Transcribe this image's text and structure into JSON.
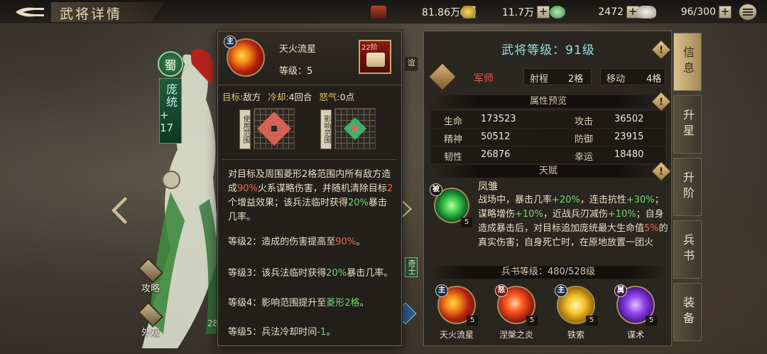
{
  "header": {
    "title": "武将详情",
    "resources": [
      {
        "icon": "food-icon",
        "value": "81.86万"
      },
      {
        "icon": "gold-coin-icon",
        "value": "11.7万"
      },
      {
        "icon": "jade-icon",
        "value": "2472"
      },
      {
        "icon": "silver-ingot-icon",
        "value": "96/300"
      }
    ],
    "plus": "+"
  },
  "hero": {
    "faction": "蜀",
    "name": "庞统",
    "level": "+ 17",
    "side_buttons": [
      {
        "label": "攻略"
      },
      {
        "label": "外观"
      }
    ],
    "tag_qishi": "奇士",
    "tag_small": "谊",
    "side_num": "28"
  },
  "popup": {
    "badge": "主",
    "skill_name": "天火流星",
    "skill_level": "等级：5",
    "rank": "22阶",
    "target_key": "目标",
    "target_val": "敌方",
    "cooldown_key": "冷却",
    "cooldown_val": "4回合",
    "rage_key": "怒气",
    "rage_val": "0点",
    "use_range_label": "使用范围",
    "effect_range_label": "影响范围",
    "desc_main": [
      {
        "t": "对目标及周围菱形2格范围内所有敌方造成"
      },
      {
        "t": "90%",
        "c": "hl"
      },
      {
        "t": "火系谋略伤害，并随机清除目标"
      },
      {
        "t": "2",
        "c": "hl"
      },
      {
        "t": "个增益效果；该兵法临时获得"
      },
      {
        "t": "20%",
        "c": "gr"
      },
      {
        "t": "暴击几率。"
      }
    ],
    "upgrades": [
      [
        {
          "t": "等级2：造成的伤害提高至"
        },
        {
          "t": "90%",
          "c": "hl"
        },
        {
          "t": "。"
        }
      ],
      [
        {
          "t": "等级3：该兵法临时获得"
        },
        {
          "t": "20%",
          "c": "gr"
        },
        {
          "t": "暴击几率。"
        }
      ],
      [
        {
          "t": "等级4：影响范围提升至"
        },
        {
          "t": "菱形2格",
          "c": "gr"
        },
        {
          "t": "。"
        }
      ],
      [
        {
          "t": "等级5：兵法冷却时间"
        },
        {
          "t": "-1",
          "c": "gr"
        },
        {
          "t": "。"
        }
      ]
    ]
  },
  "info": {
    "level_title": "武将等级：91级",
    "class_name": "军师",
    "range_label": "射程",
    "range_value": "2格",
    "move_label": "移动",
    "move_value": "4格",
    "attr_section": "属性预览",
    "stats": [
      {
        "k": "生命",
        "v": "173523"
      },
      {
        "k": "攻击",
        "v": "36502"
      },
      {
        "k": "精神",
        "v": "50512"
      },
      {
        "k": "防御",
        "v": "23915"
      },
      {
        "k": "韧性",
        "v": "26876"
      },
      {
        "k": "幸运",
        "v": "18480"
      }
    ],
    "talent_section": "天赋",
    "talent_badge": "被",
    "talent_level": "5",
    "talent_name": "凤雏",
    "talent_desc": [
      {
        "t": "战场中，暴击几率"
      },
      {
        "t": "+20%",
        "c": "gr"
      },
      {
        "t": "，连击抗性"
      },
      {
        "t": "+30%",
        "c": "gr"
      },
      {
        "t": "；谋略增伤"
      },
      {
        "t": "+10%",
        "c": "gr"
      },
      {
        "t": "，近战兵刃减伤"
      },
      {
        "t": "+10%",
        "c": "gr"
      },
      {
        "t": "；自身造成暴击后，对目标追加庞统最大生命值"
      },
      {
        "t": "5%",
        "c": "hl"
      },
      {
        "t": "的真实伤害；自身死亡时，在原地放置一团火"
      }
    ],
    "book_level": "兵书等级：480/528级",
    "skills": [
      {
        "badge": "主",
        "badge_type": "main",
        "style": "fire",
        "level": "5",
        "name": "天火流星"
      },
      {
        "badge": "怒",
        "badge_type": "nu",
        "style": "phoenix",
        "level": "5",
        "name": "涅槃之炎"
      },
      {
        "badge": "主",
        "badge_type": "main",
        "style": "gold",
        "level": "5",
        "name": "铁索"
      },
      {
        "badge": "属",
        "badge_type": "shu",
        "style": "purple",
        "level": "5",
        "name": "谋术"
      }
    ]
  },
  "tabs": [
    {
      "label": "信息",
      "active": true
    },
    {
      "label": "升星",
      "active": false
    },
    {
      "label": "升阶",
      "active": false
    },
    {
      "label": "兵书",
      "active": false
    },
    {
      "label": "装备",
      "active": false
    }
  ],
  "colors": {
    "highlight_red": "#e66a4a",
    "highlight_green": "#76d66e",
    "level_title": "#8fe1e0",
    "class_red": "#e05a48"
  }
}
